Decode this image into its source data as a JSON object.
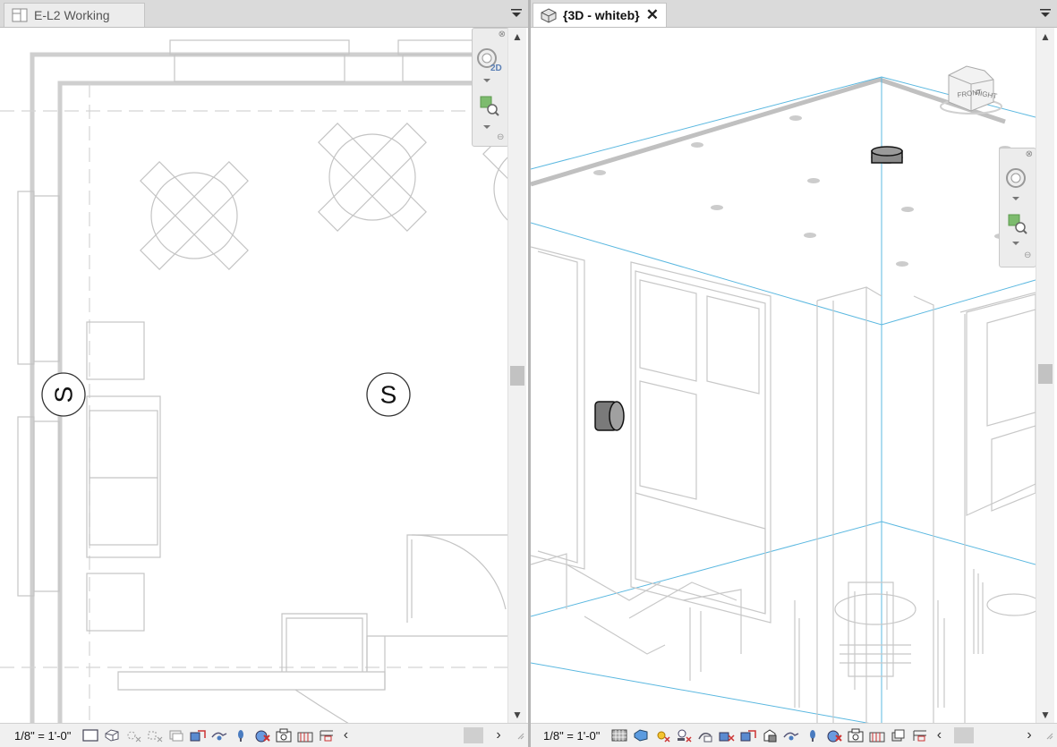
{
  "left_view": {
    "tab_title": "E-L2 Working",
    "scale": "1/8\" = 1'-0\"",
    "symbols": [
      "S",
      "S"
    ],
    "view_badge": "2D",
    "tab_icon": "floor-plan-view-icon"
  },
  "right_view": {
    "tab_title": "{3D - whiteb}",
    "scale": "1/8\" = 1'-0\"",
    "close_icon": "close-icon",
    "tab_icon": "3d-view-icon",
    "viewcube": {
      "front": "FRONT",
      "right": "RIGHT"
    }
  },
  "colors": {
    "tab_bar": "#dadada",
    "active_tab": "#ffffff",
    "line_gray": "#bdbdbd",
    "guide_blue": "#5bb8e0",
    "device_dark": "#7a7a7a"
  }
}
